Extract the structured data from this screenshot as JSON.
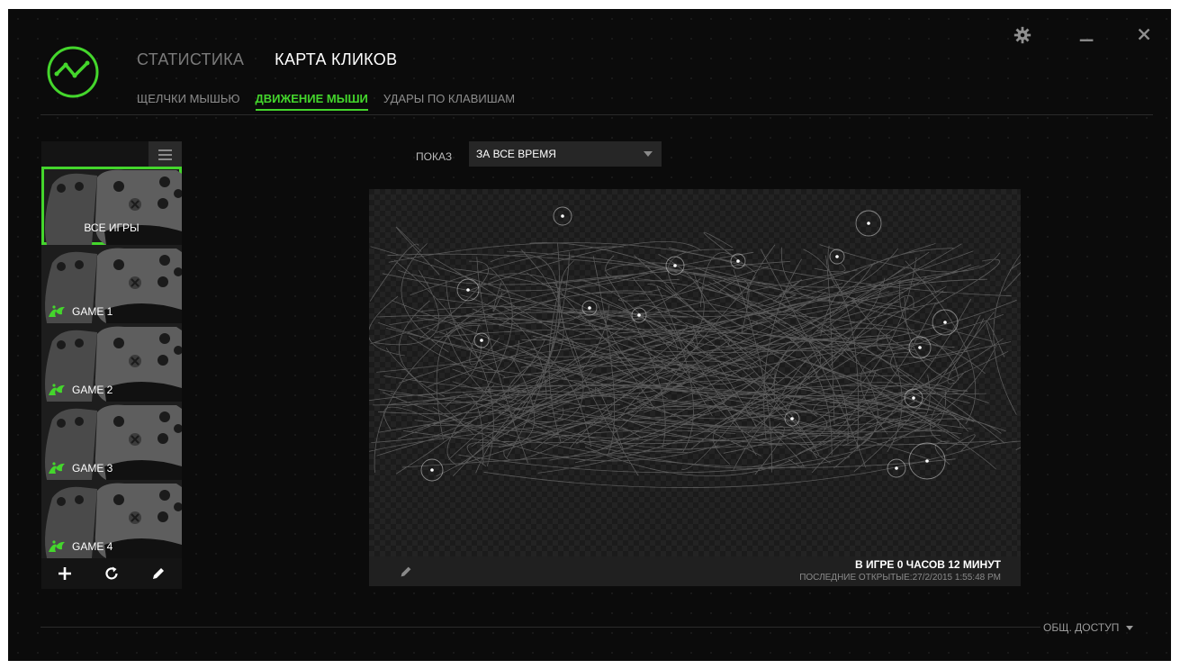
{
  "app": {
    "accent_color": "#44d62c",
    "background_color": "#0b0b0b"
  },
  "window_controls": [
    {
      "name": "settings",
      "icon": "gear-icon"
    },
    {
      "name": "minimize",
      "icon": "minimize-icon"
    },
    {
      "name": "close",
      "icon": "close-icon"
    }
  ],
  "nav": {
    "main_tabs": [
      {
        "label": "СТАТИСТИКА",
        "active": false
      },
      {
        "label": "КАРТА КЛИКОВ",
        "active": true
      }
    ],
    "sub_tabs": [
      {
        "label": "ЩЕЛЧКИ МЫШЬЮ",
        "active": false
      },
      {
        "label": "ДВИЖЕНИЕ МЫШИ",
        "active": true
      },
      {
        "label": "УДАРЫ ПО КЛАВИШАМ",
        "active": false
      }
    ]
  },
  "games": {
    "menu_icon": "hamburger-menu-icon",
    "items": [
      {
        "label": "ВСЕ ИГРЫ",
        "selected": true
      },
      {
        "label": "GAME 1",
        "icon": "razer-logo-icon"
      },
      {
        "label": "GAME 2",
        "icon": "razer-logo-icon"
      },
      {
        "label": "GAME 3",
        "icon": "razer-logo-icon"
      },
      {
        "label": "GAME 4",
        "icon": "razer-logo-icon"
      }
    ],
    "actions": [
      "plus-icon",
      "refresh-icon",
      "pencil-icon"
    ]
  },
  "filter": {
    "label": "ПОКАЗ",
    "value": "ЗА ВСЕ ВРЕМЯ"
  },
  "stats": {
    "time_played": "В ИГРЕ 0 ЧАСОВ 12 МИНУТ",
    "last_opened": "ПОСЛЕДНИЕ ОТКРЫТЫЕ:27/2/2015 1:55:48 PM"
  },
  "footer": {
    "share_label": "ОБЩ. ДОСТУП"
  }
}
